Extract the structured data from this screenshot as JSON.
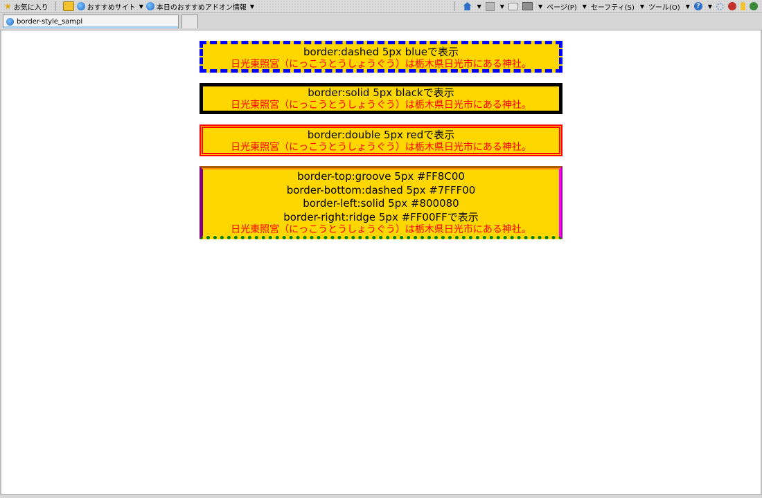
{
  "favorites_bar": {
    "favorites_label": "お気に入り",
    "suggested_sites_label": "おすすめサイト",
    "addons_label": "本日のおすすめアドオン情報"
  },
  "command_bar": {
    "page_label": "ページ(P)",
    "safety_label": "セーフティ(S)",
    "tools_label": "ツール(O)"
  },
  "tabs": [
    {
      "label": "border-style_sampl"
    }
  ],
  "samples": [
    {
      "title_lines": [
        "border:dashed 5px blueで表示"
      ],
      "desc": "日光東照宮（にっこうとうしょうぐう）は栃木県日光市にある神社。"
    },
    {
      "title_lines": [
        "border:solid 5px blackで表示"
      ],
      "desc": "日光東照宮（にっこうとうしょうぐう）は栃木県日光市にある神社。"
    },
    {
      "title_lines": [
        "border:double 5px redで表示"
      ],
      "desc": "日光東照宮（にっこうとうしょうぐう）は栃木県日光市にある神社。"
    },
    {
      "title_lines": [
        "border-top:groove 5px #FF8C00",
        "border-bottom:dashed 5px #7FFF00",
        "border-left:solid 5px #800080",
        "border-right:ridge 5px #FF00FFで表示"
      ],
      "desc": "日光東照宮（にっこうとうしょうぐう）は栃木県日光市にある神社。"
    }
  ],
  "colors": {
    "box_background": "#FFD700",
    "desc_text": "#FF0000",
    "box1_border": "#0000FF",
    "box2_border": "#000000",
    "box3_border": "#FF0000",
    "box4_top": "#FF8C00",
    "box4_bottom": "#008000",
    "box4_left": "#800080",
    "box4_right": "#FF00FF"
  }
}
